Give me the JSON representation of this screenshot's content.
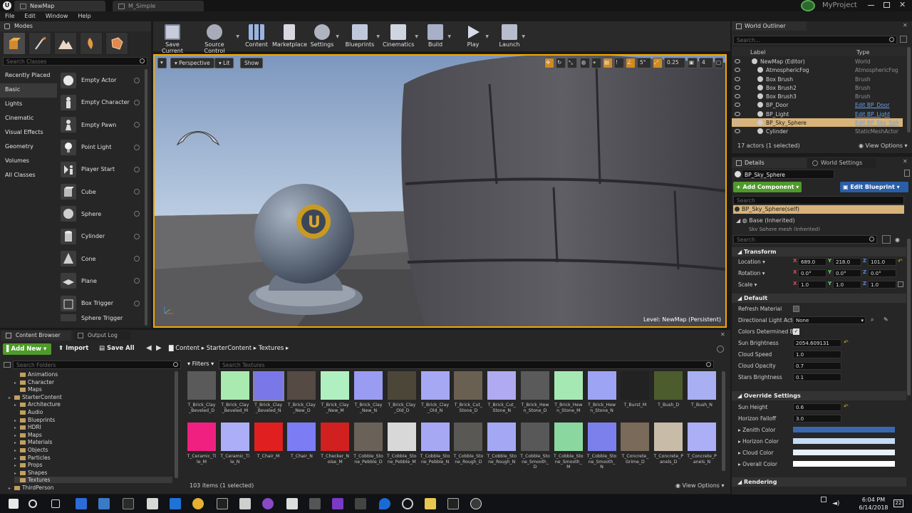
{
  "titlebar": {
    "tabs": [
      "NewMap",
      "M_Simple"
    ],
    "project": "MyProject"
  },
  "menu": [
    "File",
    "Edit",
    "Window",
    "Help"
  ],
  "modes": {
    "title": "Modes",
    "search_placeholder": "Search Classes",
    "categories": [
      "Recently Placed",
      "Basic",
      "Lights",
      "Cinematic",
      "Visual Effects",
      "Geometry",
      "Volumes",
      "All Classes"
    ],
    "selected_category": "Basic",
    "classes": [
      "Empty Actor",
      "Empty Character",
      "Empty Pawn",
      "Point Light",
      "Player Start",
      "Cube",
      "Sphere",
      "Cylinder",
      "Cone",
      "Plane",
      "Box Trigger",
      "Sphere Trigger"
    ]
  },
  "toolbar": [
    "Save Current",
    "Source Control",
    "Content",
    "Marketplace",
    "Settings",
    "Blueprints",
    "Cinematics",
    "Build",
    "Play",
    "Launch"
  ],
  "viewport": {
    "perspective": "Perspective",
    "lit": "Lit",
    "show": "Show",
    "grid_snap": "5°",
    "scale_snap": "0.25",
    "camera_speed": "4",
    "level_label": "Level:",
    "level_name": "NewMap (Persistent)"
  },
  "outliner": {
    "title": "World Outliner",
    "search_placeholder": "Search...",
    "col_label": "Label",
    "col_type": "Type",
    "rows": [
      {
        "label": "NewMap (Editor)",
        "type": "World",
        "link": false
      },
      {
        "label": "AtmosphericFog",
        "type": "AtmosphericFog",
        "link": false
      },
      {
        "label": "Box Brush",
        "type": "Brush",
        "link": false
      },
      {
        "label": "Box Brush2",
        "type": "Brush",
        "link": false
      },
      {
        "label": "Box Brush3",
        "type": "Brush",
        "link": false
      },
      {
        "label": "BP_Door",
        "type": "Edit BP_Door",
        "link": true
      },
      {
        "label": "BP_Light",
        "type": "Edit BP_Light",
        "link": true
      },
      {
        "label": "BP_Sky_Sphere",
        "type": "Edit BP_Sky_Sph",
        "link": true
      },
      {
        "label": "Cylinder",
        "type": "StaticMeshActor",
        "link": false
      }
    ],
    "selected_index": 7,
    "status": "17 actors (1 selected)",
    "view_options": "View Options"
  },
  "details": {
    "tabs": [
      "Details",
      "World Settings"
    ],
    "object_name": "BP_Sky_Sphere",
    "add_component": "+ Add Component",
    "edit_blueprint": "Edit Blueprint",
    "search_placeholder": "Search",
    "self_item": "BP_Sky_Sphere(self)",
    "base_item": "Base (Inherited)",
    "sub_item": "Sky Sphere mesh (Inherited)",
    "transform": {
      "title": "Transform",
      "location": {
        "label": "Location",
        "x": "689.0",
        "y": "218.0",
        "z": "101.0"
      },
      "rotation": {
        "label": "Rotation",
        "x": "0.0°",
        "y": "0.0°",
        "z": "0.0°"
      },
      "scale": {
        "label": "Scale",
        "x": "1.0",
        "y": "1.0",
        "z": "1.0"
      }
    },
    "default": {
      "title": "Default",
      "refresh_material": "Refresh Material",
      "dir_light_actor": "Directional Light Actor",
      "dir_light_value": "None",
      "colors_determined": "Colors Determined By",
      "sun_brightness": {
        "label": "Sun Brightness",
        "value": "2054.609131"
      },
      "cloud_speed": {
        "label": "Cloud Speed",
        "value": "1.0"
      },
      "cloud_opacity": {
        "label": "Cloud Opacity",
        "value": "0.7"
      },
      "stars_brightness": {
        "label": "Stars Brightness",
        "value": "0.1"
      }
    },
    "override": {
      "title": "Override Settings",
      "sun_height": {
        "label": "Sun Height",
        "value": "0.6"
      },
      "horizon_falloff": {
        "label": "Horizon Falloff",
        "value": "3.0"
      },
      "zenith_color": "Zenith Color",
      "horizon_color": "Horizon Color",
      "cloud_color": "Cloud Color",
      "overall_color": "Overall Color"
    },
    "rendering_title": "Rendering",
    "colors": {
      "zenith": "#3a68b0",
      "horizon": "#c4dcf2",
      "cloud": "#e8f0fa",
      "overall": "#ffffff"
    }
  },
  "content_browser": {
    "tabs": [
      "Content Browser",
      "Output Log"
    ],
    "add_new": "Add New",
    "import": "Import",
    "save_all": "Save All",
    "breadcrumb": [
      "Content",
      "StarterContent",
      "Textures"
    ],
    "search_folders": "Search Folders",
    "filters": "Filters",
    "search_textures": "Search Textures",
    "folders": [
      "Animations",
      "Character",
      "Maps",
      "StarterContent",
      "Architecture",
      "Audio",
      "Blueprints",
      "HDRI",
      "Maps",
      "Materials",
      "Objects",
      "Particles",
      "Props",
      "Shapes",
      "Textures",
      "ThirdPerson"
    ],
    "status": "103 items (1 selected)",
    "view_options": "View Options",
    "assets_row1": [
      {
        "name": "T_Brick_Clay_Beveled_D",
        "color": "#5a5a5a"
      },
      {
        "name": "T_Brick_Clay_Beveled_M",
        "color": "#a8eab0"
      },
      {
        "name": "T_Brick_Clay_Beveled_N",
        "color": "#7a78e8"
      },
      {
        "name": "T_Brick_Clay_New_D",
        "color": "#554a44"
      },
      {
        "name": "T_Brick_Clay_New_M",
        "color": "#b0f0c0"
      },
      {
        "name": "T_Brick_Clay_New_N",
        "color": "#9a9cf2"
      },
      {
        "name": "T_Brick_Clay_Old_D",
        "color": "#4c4638"
      },
      {
        "name": "T_Brick_Clay_Old_N",
        "color": "#a6a8f4"
      },
      {
        "name": "T_Brick_Cut_Stone_D",
        "color": "#6a6052"
      },
      {
        "name": "T_Brick_Cut_Stone_N",
        "color": "#b0aaf0"
      },
      {
        "name": "T_Brick_Hewn_Stone_D",
        "color": "#5a5a5a"
      },
      {
        "name": "T_Brick_Hewn_Stone_M",
        "color": "#a6e8b4"
      },
      {
        "name": "T_Brick_Hewn_Stone_N",
        "color": "#9ea4f4"
      },
      {
        "name": "T_Burst_M",
        "color": "#222222"
      },
      {
        "name": "T_Bush_D",
        "color": "#4c5c2c"
      },
      {
        "name": "T_Bush_N",
        "color": "#a8b0f2"
      }
    ],
    "assets_row2": [
      {
        "name": "T_Ceramic_Tile_M",
        "color": "#f02080"
      },
      {
        "name": "T_Ceramic_Tile_N",
        "color": "#acaef8"
      },
      {
        "name": "T_Chair_M",
        "color": "#e02020"
      },
      {
        "name": "T_Chair_N",
        "color": "#7c7cf4"
      },
      {
        "name": "T_Checker_Noise_M",
        "color": "#d02020"
      },
      {
        "name": "T_Cobble_Stone_Pebble_D",
        "color": "#6a6258"
      },
      {
        "name": "T_Cobble_Stone_Pebble_M",
        "color": "#d8d8d8"
      },
      {
        "name": "T_Cobble_Stone_Pebble_N",
        "color": "#a6a8f4"
      },
      {
        "name": "T_Cobble_Stone_Rough_D",
        "color": "#5a5854"
      },
      {
        "name": "T_Cobble_Stone_Rough_N",
        "color": "#a4a8f4"
      },
      {
        "name": "T_Cobble_Stone_Smooth_D",
        "color": "#585858"
      },
      {
        "name": "T_Cobble_Stone_Smooth_M",
        "color": "#8ad8a0"
      },
      {
        "name": "T_Cobble_Stone_Smooth_N",
        "color": "#7c80ec"
      },
      {
        "name": "T_Concrete_Grime_D",
        "color": "#7a6a5a"
      },
      {
        "name": "T_Concrete_Panels_D",
        "color": "#c8bca8"
      },
      {
        "name": "T_Concrete_Panels_N",
        "color": "#acaef6"
      }
    ]
  },
  "taskbar": {
    "time": "6:04 PM",
    "date": "6/14/2018",
    "notif": "22"
  }
}
